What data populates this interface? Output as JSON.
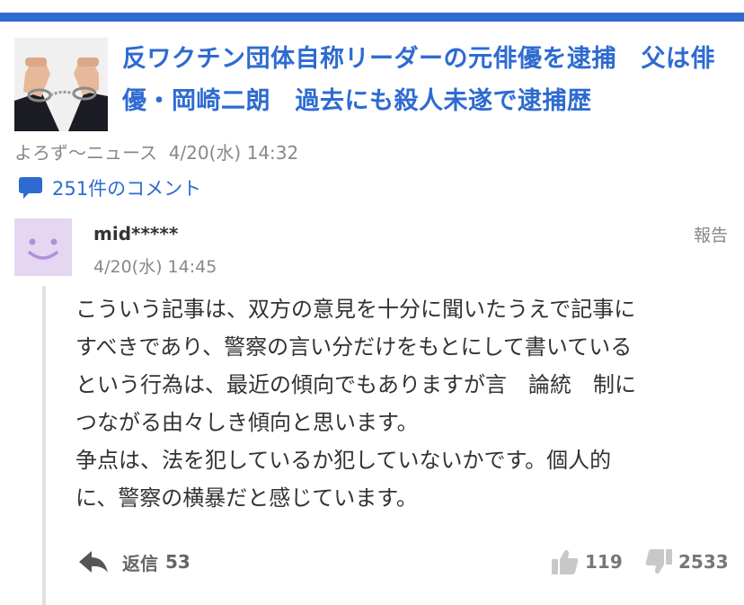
{
  "colors": {
    "accent": "#2e6bd1",
    "meta_gray": "#888888",
    "avatar_bg": "#e5d6f1",
    "avatar_face": "#b48ede",
    "icon_gray": "#c8c8c8"
  },
  "article": {
    "headline": "反ワクチン団体自称リーダーの元俳優を逮捕　父は俳優・岡崎二朗　過去にも殺人未遂で逮捕歴",
    "source": "よろず〜ニュース",
    "date": "4/20(水) 14:32",
    "thumbnail_icon": "handcuffs-photo"
  },
  "comments_link": {
    "icon": "speech-bubble-icon",
    "label": "251件のコメント"
  },
  "comment": {
    "avatar_icon": "smiley-face-icon",
    "username": "mid*****",
    "time": "4/20(水) 14:45",
    "report_label": "報告",
    "body_lines": [
      "こういう記事は、双方の意見を十分に聞いたうえで記事に",
      "すべきであり、警察の言い分だけをもとにして書いている",
      "という行為は、最近の傾向でもありますが言　論統　制に",
      "つながる由々しき傾向と思います。",
      "争点は、法を犯しているか犯していないかです。個人的",
      "に、警察の横暴だと感じています。"
    ],
    "reply_icon": "reply-arrow-icon",
    "reply_label": "返信",
    "reply_count": "53",
    "like_icon": "thumbs-up-icon",
    "like_count": "119",
    "dislike_icon": "thumbs-down-icon",
    "dislike_count": "2533"
  }
}
